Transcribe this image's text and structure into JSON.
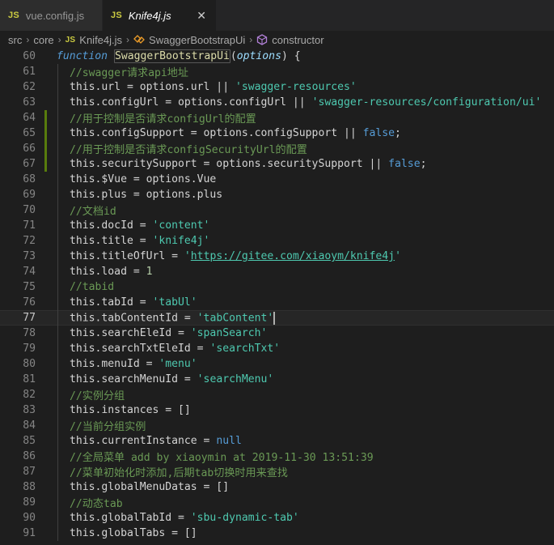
{
  "tabs": [
    {
      "badge": "JS",
      "name": "vue.config.js",
      "active": false
    },
    {
      "badge": "JS",
      "name": "Knife4j.js",
      "active": true,
      "close": "✕"
    }
  ],
  "breadcrumb": {
    "items": [
      "src",
      "core",
      "Knife4j.js",
      "SwaggerBootstrapUi",
      "constructor"
    ],
    "badge": "JS"
  },
  "lines": [
    {
      "n": "60"
    },
    {
      "n": "61"
    },
    {
      "n": "62"
    },
    {
      "n": "63"
    },
    {
      "n": "64"
    },
    {
      "n": "65"
    },
    {
      "n": "66"
    },
    {
      "n": "67"
    },
    {
      "n": "68"
    },
    {
      "n": "69"
    },
    {
      "n": "70"
    },
    {
      "n": "71"
    },
    {
      "n": "72"
    },
    {
      "n": "73"
    },
    {
      "n": "74"
    },
    {
      "n": "75"
    },
    {
      "n": "76"
    },
    {
      "n": "77"
    },
    {
      "n": "78"
    },
    {
      "n": "79"
    },
    {
      "n": "80"
    },
    {
      "n": "81"
    },
    {
      "n": "82"
    },
    {
      "n": "83"
    },
    {
      "n": "84"
    },
    {
      "n": "85"
    },
    {
      "n": "86"
    },
    {
      "n": "87"
    },
    {
      "n": "88"
    },
    {
      "n": "89"
    },
    {
      "n": "90"
    },
    {
      "n": "91"
    }
  ],
  "code": {
    "l60": {
      "kw": "function",
      "fn": "SwaggerBootstrapUi",
      "p1": "(",
      "param": "options",
      "p2": ") {"
    },
    "l61": "//swagger请求api地址",
    "l62": {
      "a": "this.url = options.url || ",
      "s": "'swagger-resources'"
    },
    "l63": {
      "a": "this.configUrl = options.configUrl || ",
      "s": "'swagger-resources/configuration/ui'"
    },
    "l64": "//用于控制是否请求configUrl的配置",
    "l65": {
      "a": "this.configSupport = options.configSupport || ",
      "k": "false",
      "e": ";"
    },
    "l66": "//用于控制是否请求configSecurityUrl的配置",
    "l67": {
      "a": "this.securitySupport = options.securitySupport || ",
      "k": "false",
      "e": ";"
    },
    "l68": "this.$Vue = options.Vue",
    "l69": "this.plus = options.plus",
    "l70": "//文档id",
    "l71": {
      "a": "this.docId = ",
      "s": "'content'"
    },
    "l72": {
      "a": "this.title = ",
      "s": "'knife4j'"
    },
    "l73": {
      "a": "this.titleOfUrl = ",
      "q1": "'",
      "u": "https://gitee.com/xiaoym/knife4j",
      "q2": "'"
    },
    "l74": {
      "a": "this.load = ",
      "num": "1"
    },
    "l75": "//tabid",
    "l76": {
      "a": "this.tabId = ",
      "s": "'tabUl'"
    },
    "l77": {
      "a": "this.tabContentId = ",
      "s": "'tabContent'"
    },
    "l78": {
      "a": "this.searchEleId = ",
      "s": "'spanSearch'"
    },
    "l79": {
      "a": "this.searchTxtEleId = ",
      "s": "'searchTxt'"
    },
    "l80": {
      "a": "this.menuId = ",
      "s": "'menu'"
    },
    "l81": {
      "a": "this.searchMenuId = ",
      "s": "'searchMenu'"
    },
    "l82": "//实例分组",
    "l83": "this.instances = []",
    "l84": "//当前分组实例",
    "l85": {
      "a": "this.currentInstance = ",
      "k": "null"
    },
    "l86": "//全局菜单 add by xiaoymin at 2019-11-30 13:51:39",
    "l87": "//菜单初始化时添加,后期tab切换时用来查找",
    "l88": "this.globalMenuDatas = []",
    "l89": "//动态tab",
    "l90": {
      "a": "this.globalTabId = ",
      "s": "'sbu-dynamic-tab'"
    },
    "l91": "this.globalTabs = []"
  },
  "colors": {
    "change_added": "#587c0c",
    "change_modified": "#0c7d9d"
  }
}
